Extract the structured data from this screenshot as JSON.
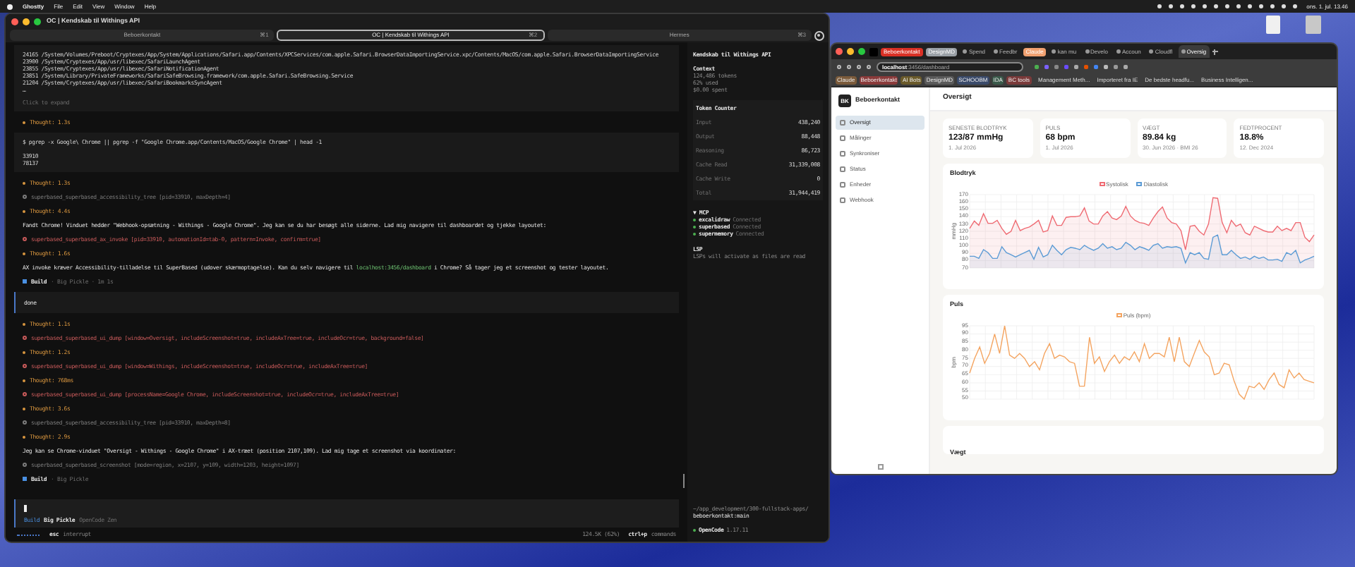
{
  "menu_bar": {
    "app": "Ghostty",
    "items": [
      "File",
      "Edit",
      "View",
      "Window",
      "Help"
    ],
    "clock": "ons. 1. jul. 13.46"
  },
  "terminal": {
    "title": "OC | Kendskab til Withings API",
    "tabs": [
      {
        "label": "Beboerkontakt",
        "shortcut": "⌘1",
        "selected": false
      },
      {
        "label": "OC | Kendskab til Withings API",
        "shortcut": "⌘2",
        "selected": true
      },
      {
        "label": "Hermes",
        "shortcut": "⌘3",
        "selected": false
      }
    ],
    "log": [
      {
        "kind": "block",
        "lines": [
          "24165 /System/Volumes/Preboot/Cryptexes/App/System/Applications/Safari.app/Contents/XPCServices/com.apple.Safari.BrowserDataImportingService.xpc/Contents/MacOS/com.apple.Safari.BrowserDataImportingService",
          "23900 /System/Cryptexes/App/usr/libexec/SafariLaunchAgent",
          "23855 /System/Cryptexes/App/usr/libexec/SafariNotificationAgent",
          "23851 /System/Library/PrivateFrameworks/SafariSafeBrowsing.framework/com.apple.Safari.SafeBrowsing.Service",
          "21204 /System/Cryptexes/App/usr/libexec/SafariBookmarksSyncAgent",
          "…"
        ],
        "hint": "Click to expand"
      },
      {
        "kind": "thought",
        "text": "Thought: 1.3s"
      },
      {
        "kind": "block",
        "command": "$ pgrep -x Google\\ Chrome || pgrep -f \"Google Chrome.app/Contents/MacOS/Google Chrome\" | head -1",
        "lines": [
          "33910",
          "78137"
        ]
      },
      {
        "kind": "thought",
        "text": "Thought: 1.3s"
      },
      {
        "kind": "tool",
        "failed": false,
        "text": "superbased_superbased_accessibility_tree [pid=33910, maxDepth=4]"
      },
      {
        "kind": "thought",
        "text": "Thought: 4.4s"
      },
      {
        "kind": "text",
        "parts": [
          {
            "text": "Fandt Chrome! Vinduet hedder \"Webhook-opsætning - Withings - Google Chrome\". Jeg kan se du har besøgt alle siderne. Lad mig navigere til dashboardet og tjekke layoutet:",
            "link": false
          }
        ]
      },
      {
        "kind": "tool",
        "failed": true,
        "text": "superbased_superbased_ax_invoke [pid=33910, automationId=tab-0, pattern=Invoke, confirm=true]"
      },
      {
        "kind": "thought",
        "text": "Thought: 1.6s"
      },
      {
        "kind": "text",
        "parts": [
          {
            "text": "AX invoke kræver Accessibility-tilladelse til SuperBased (udover skærmoptagelse). Kan du selv navigere til ",
            "link": false
          },
          {
            "text": "localhost:3456/dashboard",
            "link": true
          },
          {
            "text": " i Chrome? Så tager jeg et screenshot og tester layoutet.",
            "link": false
          }
        ]
      },
      {
        "kind": "build",
        "agent": "Build",
        "detail": "· Big Pickle · 1m 1s"
      },
      {
        "kind": "user",
        "text": "done"
      },
      {
        "kind": "thought",
        "text": "Thought: 1.1s"
      },
      {
        "kind": "tool",
        "failed": true,
        "text": "superbased_superbased_ui_dump [window=Oversigt, includeScreenshot=true, includeAxTree=true, includeOcr=true, background=false]"
      },
      {
        "kind": "thought",
        "text": "Thought: 1.2s"
      },
      {
        "kind": "tool",
        "failed": true,
        "text": "superbased_superbased_ui_dump [window=Withings, includeScreenshot=true, includeOcr=true, includeAxTree=true]"
      },
      {
        "kind": "thought",
        "text": "Thought: 768ms"
      },
      {
        "kind": "tool",
        "failed": true,
        "text": "superbased_superbased_ui_dump [processName=Google Chrome, includeScreenshot=true, includeOcr=true, includeAxTree=true]"
      },
      {
        "kind": "thought",
        "text": "Thought: 3.6s"
      },
      {
        "kind": "tool",
        "failed": false,
        "text": "superbased_superbased_accessibility_tree [pid=33910, maxDepth=8]"
      },
      {
        "kind": "thought",
        "text": "Thought: 2.9s"
      },
      {
        "kind": "text",
        "parts": [
          {
            "text": "Jeg kan se Chrome-vinduet \"Oversigt - Withings - Google Chrome\" i AX-træet (position 2107,109). Lad mig tage et screenshot via koordinater:",
            "link": false
          }
        ]
      },
      {
        "kind": "tool",
        "failed": false,
        "text": "superbased_superbased_screenshot [mode=region, x=2107, y=109, width=1203, height=1097]"
      },
      {
        "kind": "build",
        "agent": "Build",
        "detail": "· Big Pickle"
      }
    ],
    "prompt": {
      "agent": "Build",
      "model": "Big Pickle",
      "provider": "OpenCode Zen"
    },
    "status": {
      "key": "esc",
      "action": "interrupt",
      "usage": "124.5K (62%)",
      "shortcut": "ctrl+p",
      "shortcut_action": "commands"
    },
    "sidebar": {
      "title": "Kendskab til Withings API",
      "context_heading": "Context",
      "context": [
        "124,486 tokens",
        "62% used",
        "$0.00 spent"
      ],
      "token_heading": "Token Counter",
      "tokens": [
        {
          "label": "Input",
          "value": "438,240"
        },
        {
          "label": "Output",
          "value": "88,448"
        },
        {
          "label": "Reasoning",
          "value": "86,723"
        },
        {
          "label": "Cache Read",
          "value": "31,339,008"
        },
        {
          "label": "Cache Write",
          "value": "0"
        },
        {
          "label": "Total",
          "value": "31,944,419"
        }
      ],
      "mcp_heading": "▼ MCP",
      "mcp": [
        {
          "name": "excalidraw",
          "status": "Connected",
          "color": "#4caf50"
        },
        {
          "name": "superbased",
          "status": "Connected",
          "color": "#4caf50"
        },
        {
          "name": "supermemory",
          "status": "Connected",
          "color": "#4caf50"
        }
      ],
      "lsp_heading": "LSP",
      "lsp_note": "LSPs will activate as files are read",
      "path": "~/app_development/300-fullstack-apps/",
      "branch": "beboerkontakt:main",
      "app": "OpenCode",
      "version": "1.17.11"
    }
  },
  "browser": {
    "tabs": [
      {
        "kind": "group",
        "label": "Beboerkontakt",
        "color": "#d93025"
      },
      {
        "kind": "group",
        "label": "DesignMD",
        "color": "#9aa0a6"
      },
      {
        "kind": "tab",
        "label": "Spend",
        "selected": false
      },
      {
        "kind": "tab",
        "label": "Feedbr",
        "selected": false
      },
      {
        "kind": "group",
        "label": "Claude",
        "color": "#f0a070"
      },
      {
        "kind": "tab",
        "label": "kan mu",
        "selected": false
      },
      {
        "kind": "tab",
        "label": "Develo",
        "selected": false
      },
      {
        "kind": "tab",
        "label": "Accoun",
        "selected": false
      },
      {
        "kind": "tab",
        "label": "Cloudfl",
        "selected": false
      },
      {
        "kind": "tab",
        "label": "Oversig",
        "selected": true
      }
    ],
    "url_host": "localhost",
    "url_path": ":3456/dashboard",
    "bookmarks": [
      {
        "kind": "group",
        "label": "Claude",
        "color": "#7a5a3a"
      },
      {
        "kind": "group",
        "label": "Beboerkontakt",
        "color": "#8a3a3a"
      },
      {
        "kind": "group",
        "label": "AI Bots",
        "color": "#6a5a2a"
      },
      {
        "kind": "group",
        "label": "DesignMD",
        "color": "#5a5a5a"
      },
      {
        "kind": "group",
        "label": "SCHOOBM",
        "color": "#3a4a6a"
      },
      {
        "kind": "group",
        "label": "IDA",
        "color": "#3a5a4a"
      },
      {
        "kind": "group",
        "label": "BC tools",
        "color": "#7a3a3a"
      },
      {
        "kind": "link",
        "label": "Management Meth..."
      },
      {
        "kind": "folder",
        "label": "Importeret fra IE"
      },
      {
        "kind": "link",
        "label": "De bedste headfu..."
      },
      {
        "kind": "link",
        "label": "Business Intelligen..."
      }
    ],
    "app": {
      "logo": "BK",
      "name": "Beboerkontakt",
      "nav": [
        {
          "label": "Oversigt",
          "selected": true
        },
        {
          "label": "Målinger",
          "selected": false
        },
        {
          "label": "Synkroniser",
          "selected": false
        },
        {
          "label": "Status",
          "selected": false
        },
        {
          "label": "Enheder",
          "selected": false
        },
        {
          "label": "Webhook",
          "selected": false
        }
      ],
      "heading": "Oversigt",
      "cards": [
        {
          "label": "SENESTE BLODTRYK",
          "value": "123/87 mmHg",
          "note": "1. Jul 2026"
        },
        {
          "label": "PULS",
          "value": "68 bpm",
          "note": "1. Jul 2026"
        },
        {
          "label": "VÆGT",
          "value": "89.84 kg",
          "note": "30. Jun 2026 · BMI 26"
        },
        {
          "label": "FEDTPROCENT",
          "value": "18.8%",
          "note": "12. Dec 2024"
        }
      ],
      "charts": [
        {
          "title": "Blodtryk",
          "chart_data": {
            "type": "area",
            "grid": true,
            "ylabel": "mmHg",
            "ylim": [
              70,
              170
            ],
            "yticks": [
              170,
              160,
              150,
              140,
              130,
              120,
              110,
              100,
              90,
              80,
              70
            ],
            "series": [
              {
                "name": "Systolisk",
                "color": "#ef6b73",
                "values": [
                  124,
                  134,
                  128,
                  144,
                  131,
                  131,
                  135,
                  124,
                  116,
                  120,
                  135,
                  121,
                  124,
                  126,
                  130,
                  135,
                  119,
                  121,
                  141,
                  128,
                  128,
                  139,
                  140,
                  140,
                  141,
                  152,
                  134,
                  130,
                  130,
                  141,
                  147,
                  138,
                  136,
                  141,
                  154,
                  141,
                  135,
                  132,
                  131,
                  128,
                  138,
                  147,
                  153,
                  138,
                  132,
                  130,
                  121,
                  95,
                  127,
                  128,
                  120,
                  115,
                  130,
                  166,
                  165,
                  132,
                  118,
                  135,
                  127,
                  130,
                  118,
                  115,
                  127,
                  124,
                  121,
                  119,
                  119,
                  127,
                  121,
                  124,
                  121,
                  132,
                  132,
                  112,
                  106,
                  115
                ]
              },
              {
                "name": "Diastolisk",
                "color": "#5b9bd5",
                "values": [
                  86,
                  86,
                  83,
                  95,
                  91,
                  83,
                  83,
                  99,
                  91,
                  88,
                  85,
                  88,
                  91,
                  94,
                  82,
                  98,
                  85,
                  88,
                  101,
                  94,
                  88,
                  95,
                  98,
                  97,
                  95,
                  101,
                  97,
                  94,
                  97,
                  103,
                  97,
                  99,
                  95,
                  97,
                  105,
                  101,
                  95,
                  99,
                  97,
                  94,
                  101,
                  103,
                  97,
                  99,
                  98,
                  99,
                  97,
                  77,
                  91,
                  88,
                  91,
                  83,
                  82,
                  112,
                  115,
                  88,
                  88,
                  94,
                  88,
                  83,
                  85,
                  82,
                  86,
                  83,
                  85,
                  81,
                  81,
                  82,
                  79,
                  91,
                  88,
                  94,
                  77,
                  81,
                  83,
                  86
                ]
              }
            ]
          }
        },
        {
          "title": "Puls",
          "chart_data": {
            "type": "line",
            "grid": true,
            "ylabel": "bpm",
            "ylim": [
              50,
              95
            ],
            "yticks": [
              95,
              90,
              85,
              80,
              75,
              70,
              65,
              60,
              55,
              50
            ],
            "series": [
              {
                "name": "Puls (bpm)",
                "color": "#f4a460",
                "values": [
                  66,
                  75,
                  82,
                  72,
                  78,
                  90,
                  78,
                  95,
                  77,
                  75,
                  78,
                  75,
                  70,
                  73,
                  68,
                  78,
                  84,
                  75,
                  77,
                  76,
                  73,
                  72,
                  58,
                  58,
                  88,
                  72,
                  76,
                  67,
                  73,
                  77,
                  72,
                  76,
                  74,
                  79,
                  73,
                  84,
                  75,
                  78,
                  78,
                  76,
                  88,
                  73,
                  88,
                  73,
                  70,
                  78,
                  86,
                  79,
                  76,
                  65,
                  66,
                  72,
                  71,
                  61,
                  53,
                  50,
                  58,
                  57,
                  60,
                  56,
                  62,
                  66,
                  59,
                  57,
                  68,
                  63,
                  66,
                  62,
                  61,
                  60
                ]
              }
            ]
          }
        },
        {
          "title": "Vægt"
        }
      ]
    }
  }
}
